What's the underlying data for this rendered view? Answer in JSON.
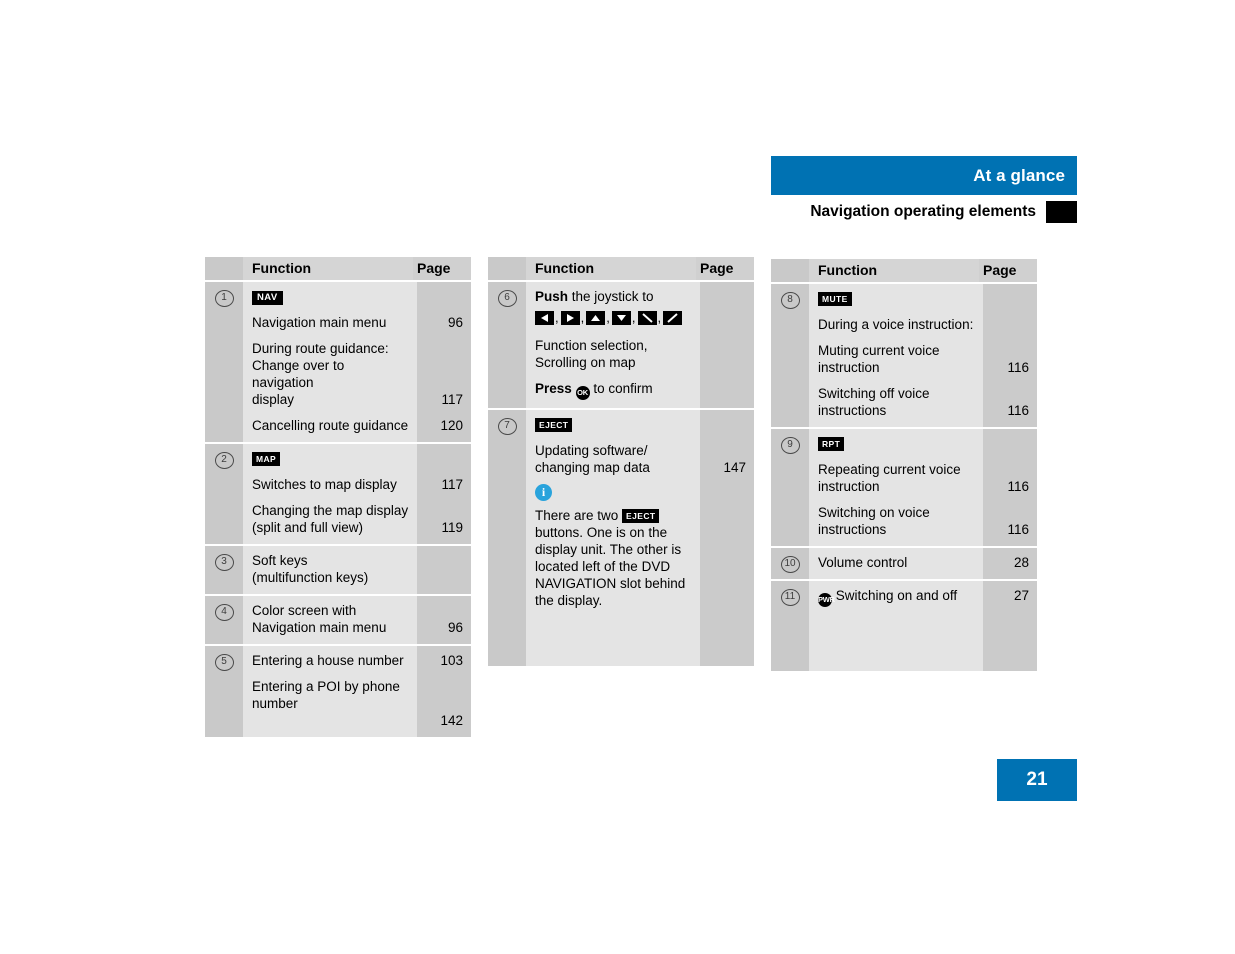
{
  "header": {
    "section_title": "At a glance",
    "subtitle": "Navigation operating elements",
    "accent_color": "#0072b3",
    "marker_color": "#000000"
  },
  "footer": {
    "page_number": "21"
  },
  "columns": {
    "header_num": "",
    "header_function": "Function",
    "header_page": "Page"
  },
  "tables": [
    {
      "id": "table-1",
      "rows": [
        {
          "num": "1",
          "badge": "NAV",
          "items": [
            {
              "text": "Navigation main menu",
              "page": "96"
            },
            {
              "text": "During route guidance:\nChange over to navigation\ndisplay",
              "page": "117"
            },
            {
              "text": "Cancelling route guidance",
              "page": "120"
            }
          ]
        },
        {
          "num": "2",
          "badge": "MAP",
          "items": [
            {
              "text": "Switches to map display",
              "page": "117"
            },
            {
              "text": "Changing the map display\n(split and full view)",
              "page": "119"
            }
          ]
        },
        {
          "num": "3",
          "badge": "",
          "items": [
            {
              "text": "Soft keys\n(multifunction keys)",
              "page": ""
            }
          ]
        },
        {
          "num": "4",
          "badge": "",
          "items": [
            {
              "text": "Color screen with\nNavigation main menu",
              "page": "96"
            }
          ]
        },
        {
          "num": "5",
          "badge": "",
          "items": [
            {
              "text": "Entering a house number",
              "page": "103"
            },
            {
              "text": "Entering a POI by phone\nnumber",
              "page": "142"
            }
          ]
        }
      ]
    },
    {
      "id": "table-2",
      "rows": [
        {
          "num": "6",
          "push_label": "Push",
          "push_rest": " the joystick to",
          "arrows": [
            "left",
            "right",
            "up",
            "down",
            "diag-down-right",
            "diag-up-right"
          ],
          "lines": [
            "Function selection,",
            "Scrolling on map"
          ],
          "press_label": "Press",
          "press_badge": "OK",
          "press_rest": " to confirm",
          "page": ""
        },
        {
          "num": "7",
          "badge": "EJECT",
          "items": [
            {
              "text": "Updating software/\nchanging map data",
              "page": "147"
            }
          ],
          "note": {
            "icon": "info-icon",
            "before": "There are two ",
            "badge": "EJECT",
            "after": "\nbuttons. One is on the\ndisplay unit. The other is\nlocated left of the DVD\nNAVIGATION slot behind\nthe display."
          }
        }
      ]
    },
    {
      "id": "table-3",
      "rows": [
        {
          "num": "8",
          "badge": "MUTE",
          "items": [
            {
              "text": "During a voice instruction:",
              "page": ""
            },
            {
              "text": "Muting current voice\ninstruction",
              "page": "116"
            },
            {
              "text": "Switching off voice\ninstructions",
              "page": "116"
            }
          ]
        },
        {
          "num": "9",
          "badge": "RPT",
          "items": [
            {
              "text": "Repeating current voice\ninstruction",
              "page": "116"
            },
            {
              "text": "Switching on voice\ninstructions",
              "page": "116"
            }
          ]
        },
        {
          "num": "10",
          "badge": "",
          "items": [
            {
              "text": "Volume control",
              "page": "28"
            }
          ]
        },
        {
          "num": "11",
          "round_badge": "PWR",
          "items": [
            {
              "text": "Switching on and off",
              "page": "27"
            }
          ]
        }
      ]
    }
  ]
}
